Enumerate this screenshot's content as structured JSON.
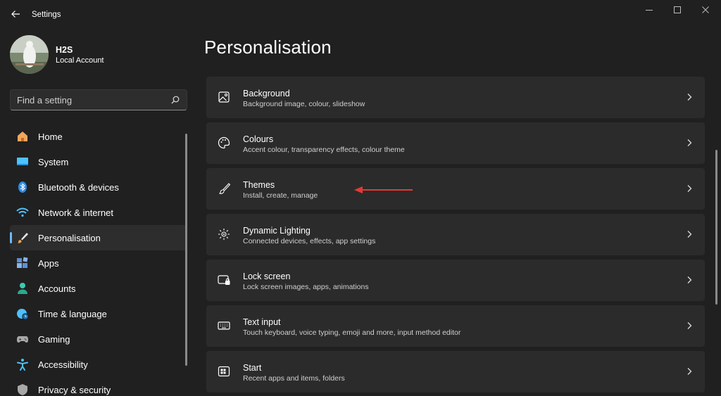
{
  "window": {
    "app_title": "Settings"
  },
  "profile": {
    "name": "H2S",
    "account_type": "Local Account"
  },
  "search": {
    "placeholder": "Find a setting"
  },
  "sidebar": {
    "items": [
      {
        "label": "Home",
        "icon": "home-icon",
        "color": "#f2a65a"
      },
      {
        "label": "System",
        "icon": "monitor-icon",
        "color": "#4cc2ff"
      },
      {
        "label": "Bluetooth & devices",
        "icon": "bluetooth-icon",
        "color": "#2b8ce6"
      },
      {
        "label": "Network & internet",
        "icon": "wifi-icon",
        "color": "#4cc2ff"
      },
      {
        "label": "Personalisation",
        "icon": "brush-icon",
        "color": "#f0a050",
        "active": true
      },
      {
        "label": "Apps",
        "icon": "apps-icon",
        "color": "#8ab4e8"
      },
      {
        "label": "Accounts",
        "icon": "person-icon",
        "color": "#3ccab0"
      },
      {
        "label": "Time & language",
        "icon": "globe-clock-icon",
        "color": "#4cc2ff"
      },
      {
        "label": "Gaming",
        "icon": "gamepad-icon",
        "color": "#a8a8a8"
      },
      {
        "label": "Accessibility",
        "icon": "accessibility-icon",
        "color": "#4cc2ff"
      },
      {
        "label": "Privacy & security",
        "icon": "shield-icon",
        "color": "#a8a8a8"
      }
    ]
  },
  "main": {
    "title": "Personalisation",
    "cards": [
      {
        "title": "Background",
        "subtitle": "Background image, colour, slideshow",
        "icon": "image-icon"
      },
      {
        "title": "Colours",
        "subtitle": "Accent colour, transparency effects, colour theme",
        "icon": "palette-icon"
      },
      {
        "title": "Themes",
        "subtitle": "Install, create, manage",
        "icon": "brush-icon"
      },
      {
        "title": "Dynamic Lighting",
        "subtitle": "Connected devices, effects, app settings",
        "icon": "lighting-icon"
      },
      {
        "title": "Lock screen",
        "subtitle": "Lock screen images, apps, animations",
        "icon": "lock-screen-icon"
      },
      {
        "title": "Text input",
        "subtitle": "Touch keyboard, voice typing, emoji and more, input method editor",
        "icon": "keyboard-icon"
      },
      {
        "title": "Start",
        "subtitle": "Recent apps and items, folders",
        "icon": "start-icon"
      }
    ]
  },
  "colors": {
    "background": "#202020",
    "card": "#2b2b2b",
    "accent": "#6fb8ff",
    "annotation_arrow": "#e53935"
  }
}
